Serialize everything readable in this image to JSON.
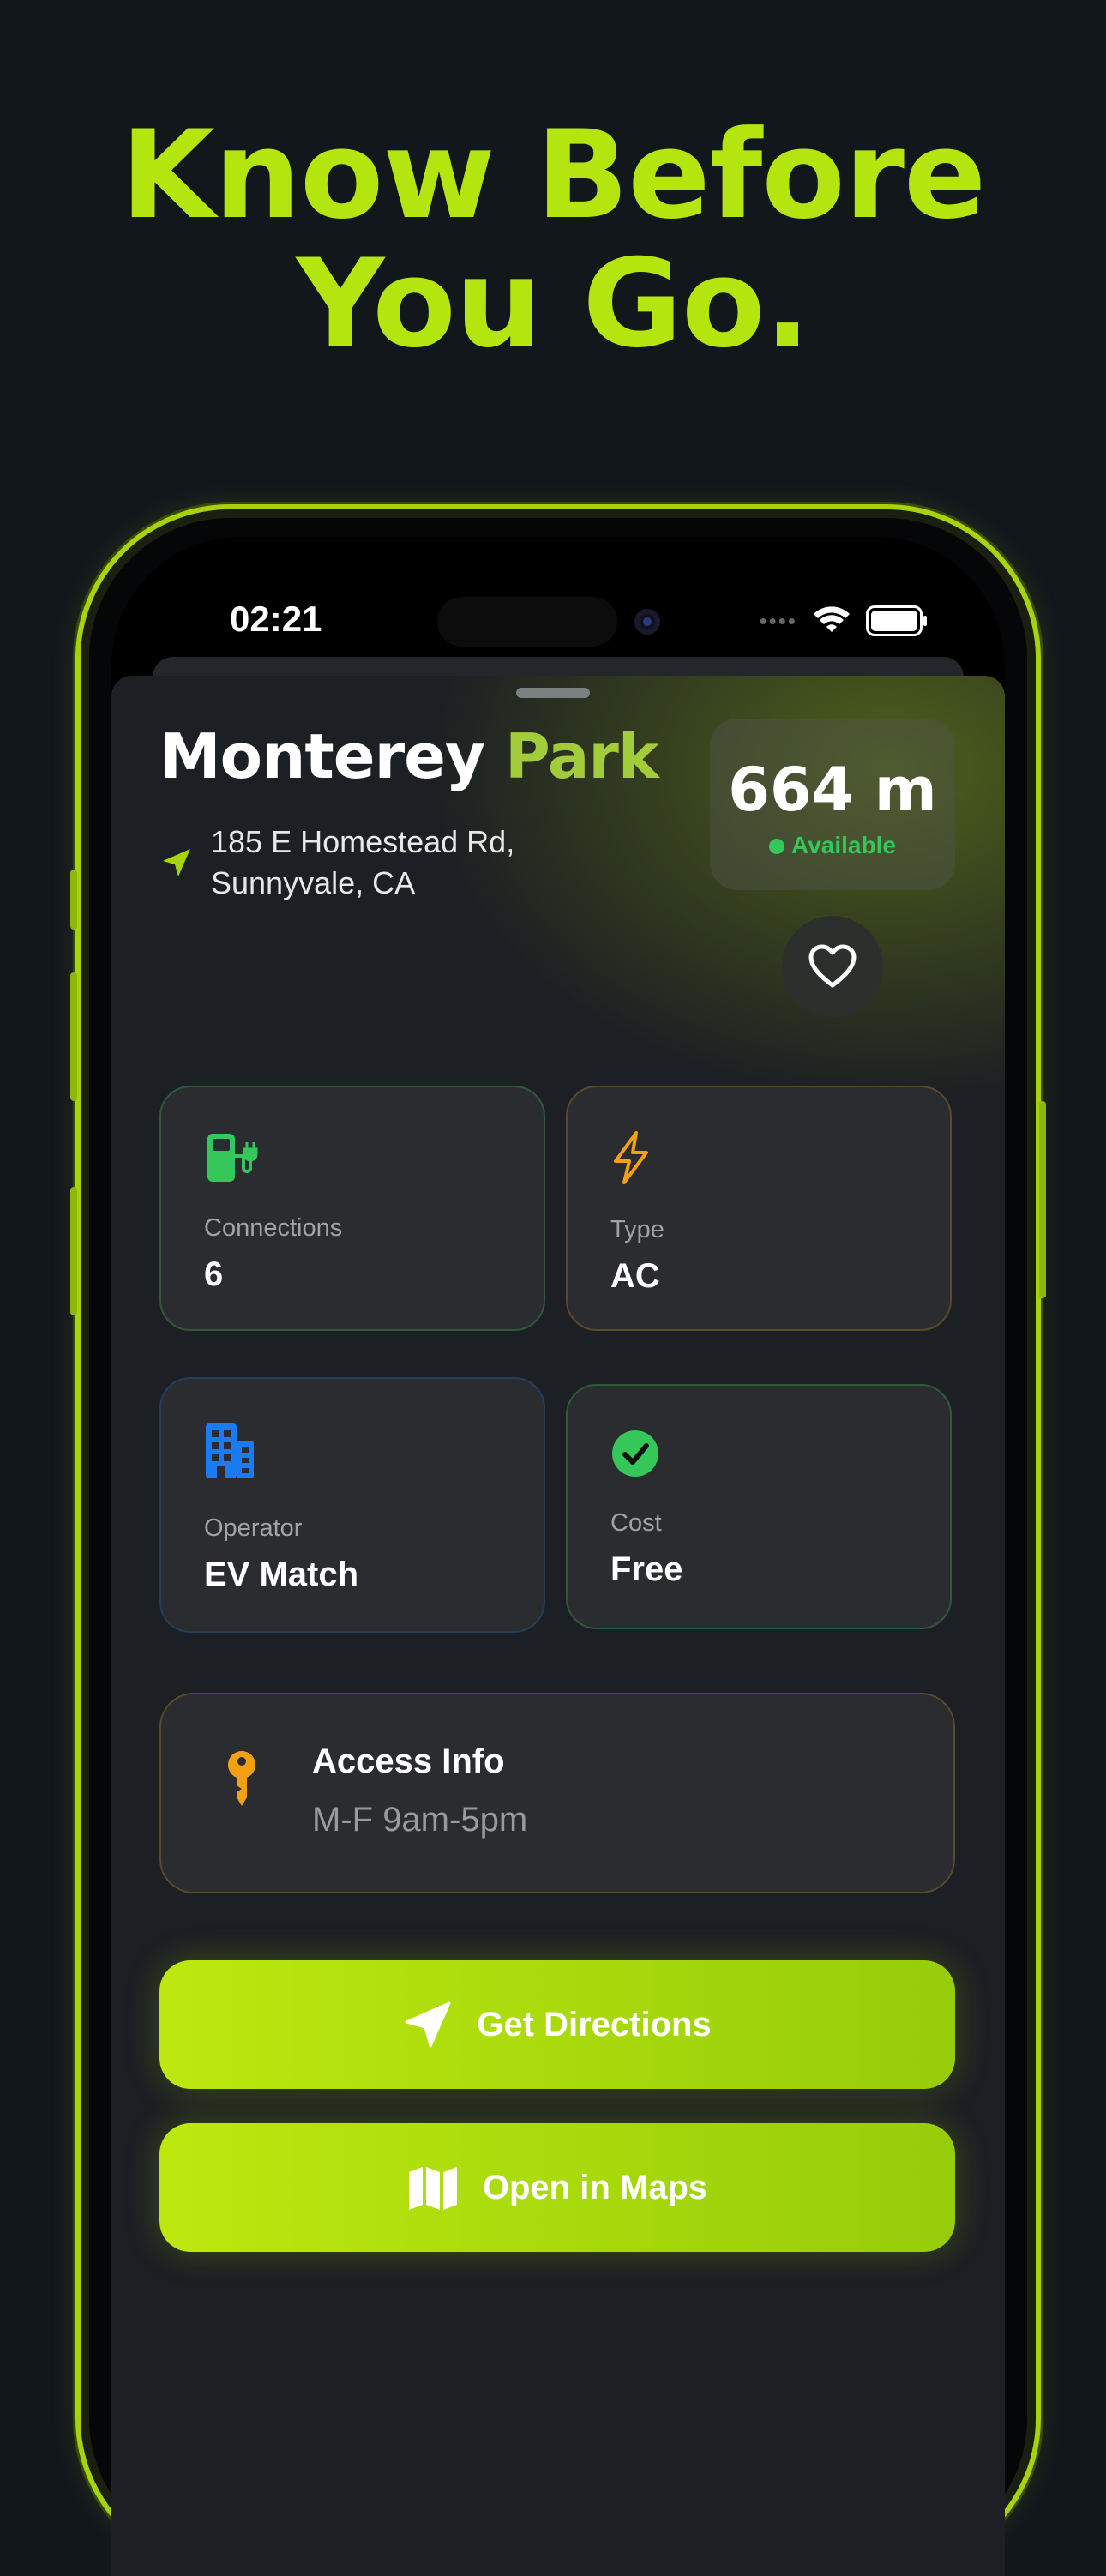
{
  "headline": {
    "line1": "Know Before",
    "line2": "You Go."
  },
  "status_bar": {
    "time": "02:21",
    "dots": "••••"
  },
  "station": {
    "name_part1": "Monterey",
    "name_part2": "Park",
    "address_line1": "185 E Homestead Rd,",
    "address_line2": "Sunnyvale, CA",
    "distance": "664 m",
    "availability": "Available"
  },
  "cards": {
    "connections": {
      "label": "Connections",
      "value": "6",
      "icon": "ev-station-icon",
      "color": "#35c759"
    },
    "type": {
      "label": "Type",
      "value": "AC",
      "icon": "bolt-icon",
      "color": "#f4a012"
    },
    "operator": {
      "label": "Operator",
      "value": "EV Match",
      "icon": "building-icon",
      "color": "#1a7cf5"
    },
    "cost": {
      "label": "Cost",
      "value": "Free",
      "icon": "checkmark-circle-icon",
      "color": "#35c759"
    }
  },
  "access": {
    "title": "Access Info",
    "hours": "M-F 9am-5pm",
    "icon": "key-icon",
    "color": "#f4a012"
  },
  "buttons": {
    "directions": "Get Directions",
    "maps": "Open in Maps"
  },
  "colors": {
    "accent": "#b5e50f",
    "background": "#12171c",
    "card": "#2a2c30"
  }
}
